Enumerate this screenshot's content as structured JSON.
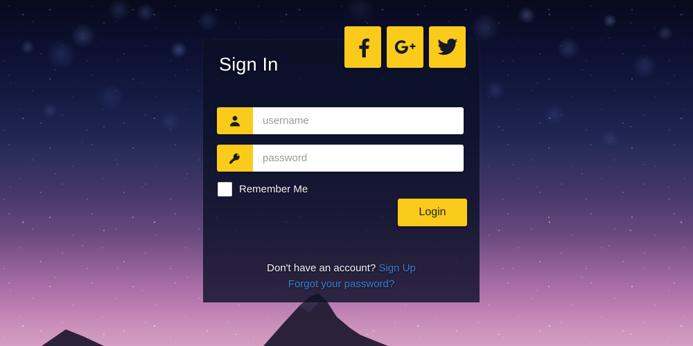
{
  "panel": {
    "title": "Sign In"
  },
  "socials": [
    {
      "name": "facebook",
      "icon": "facebook-icon",
      "label": "Facebook"
    },
    {
      "name": "google-plus",
      "icon": "google-plus-icon",
      "label": "Google Plus"
    },
    {
      "name": "twitter",
      "icon": "twitter-icon",
      "label": "Twitter"
    }
  ],
  "form": {
    "username": {
      "placeholder": "username",
      "value": "",
      "icon": "user-icon"
    },
    "password": {
      "placeholder": "password",
      "value": "",
      "icon": "key-icon"
    },
    "remember": {
      "label": "Remember Me",
      "checked": false
    },
    "submit_label": "Login"
  },
  "footer": {
    "signup_prompt": "Don't have an account?",
    "signup_link": "Sign Up",
    "forgot_link": "Forgot your password?"
  },
  "colors": {
    "accent_yellow": "#fbcb1c",
    "link_blue": "#3a7fd5",
    "panel_overlay": "rgba(11,16,38,0.80)",
    "button_text": "#20242e",
    "field_background": "#ffffff"
  }
}
